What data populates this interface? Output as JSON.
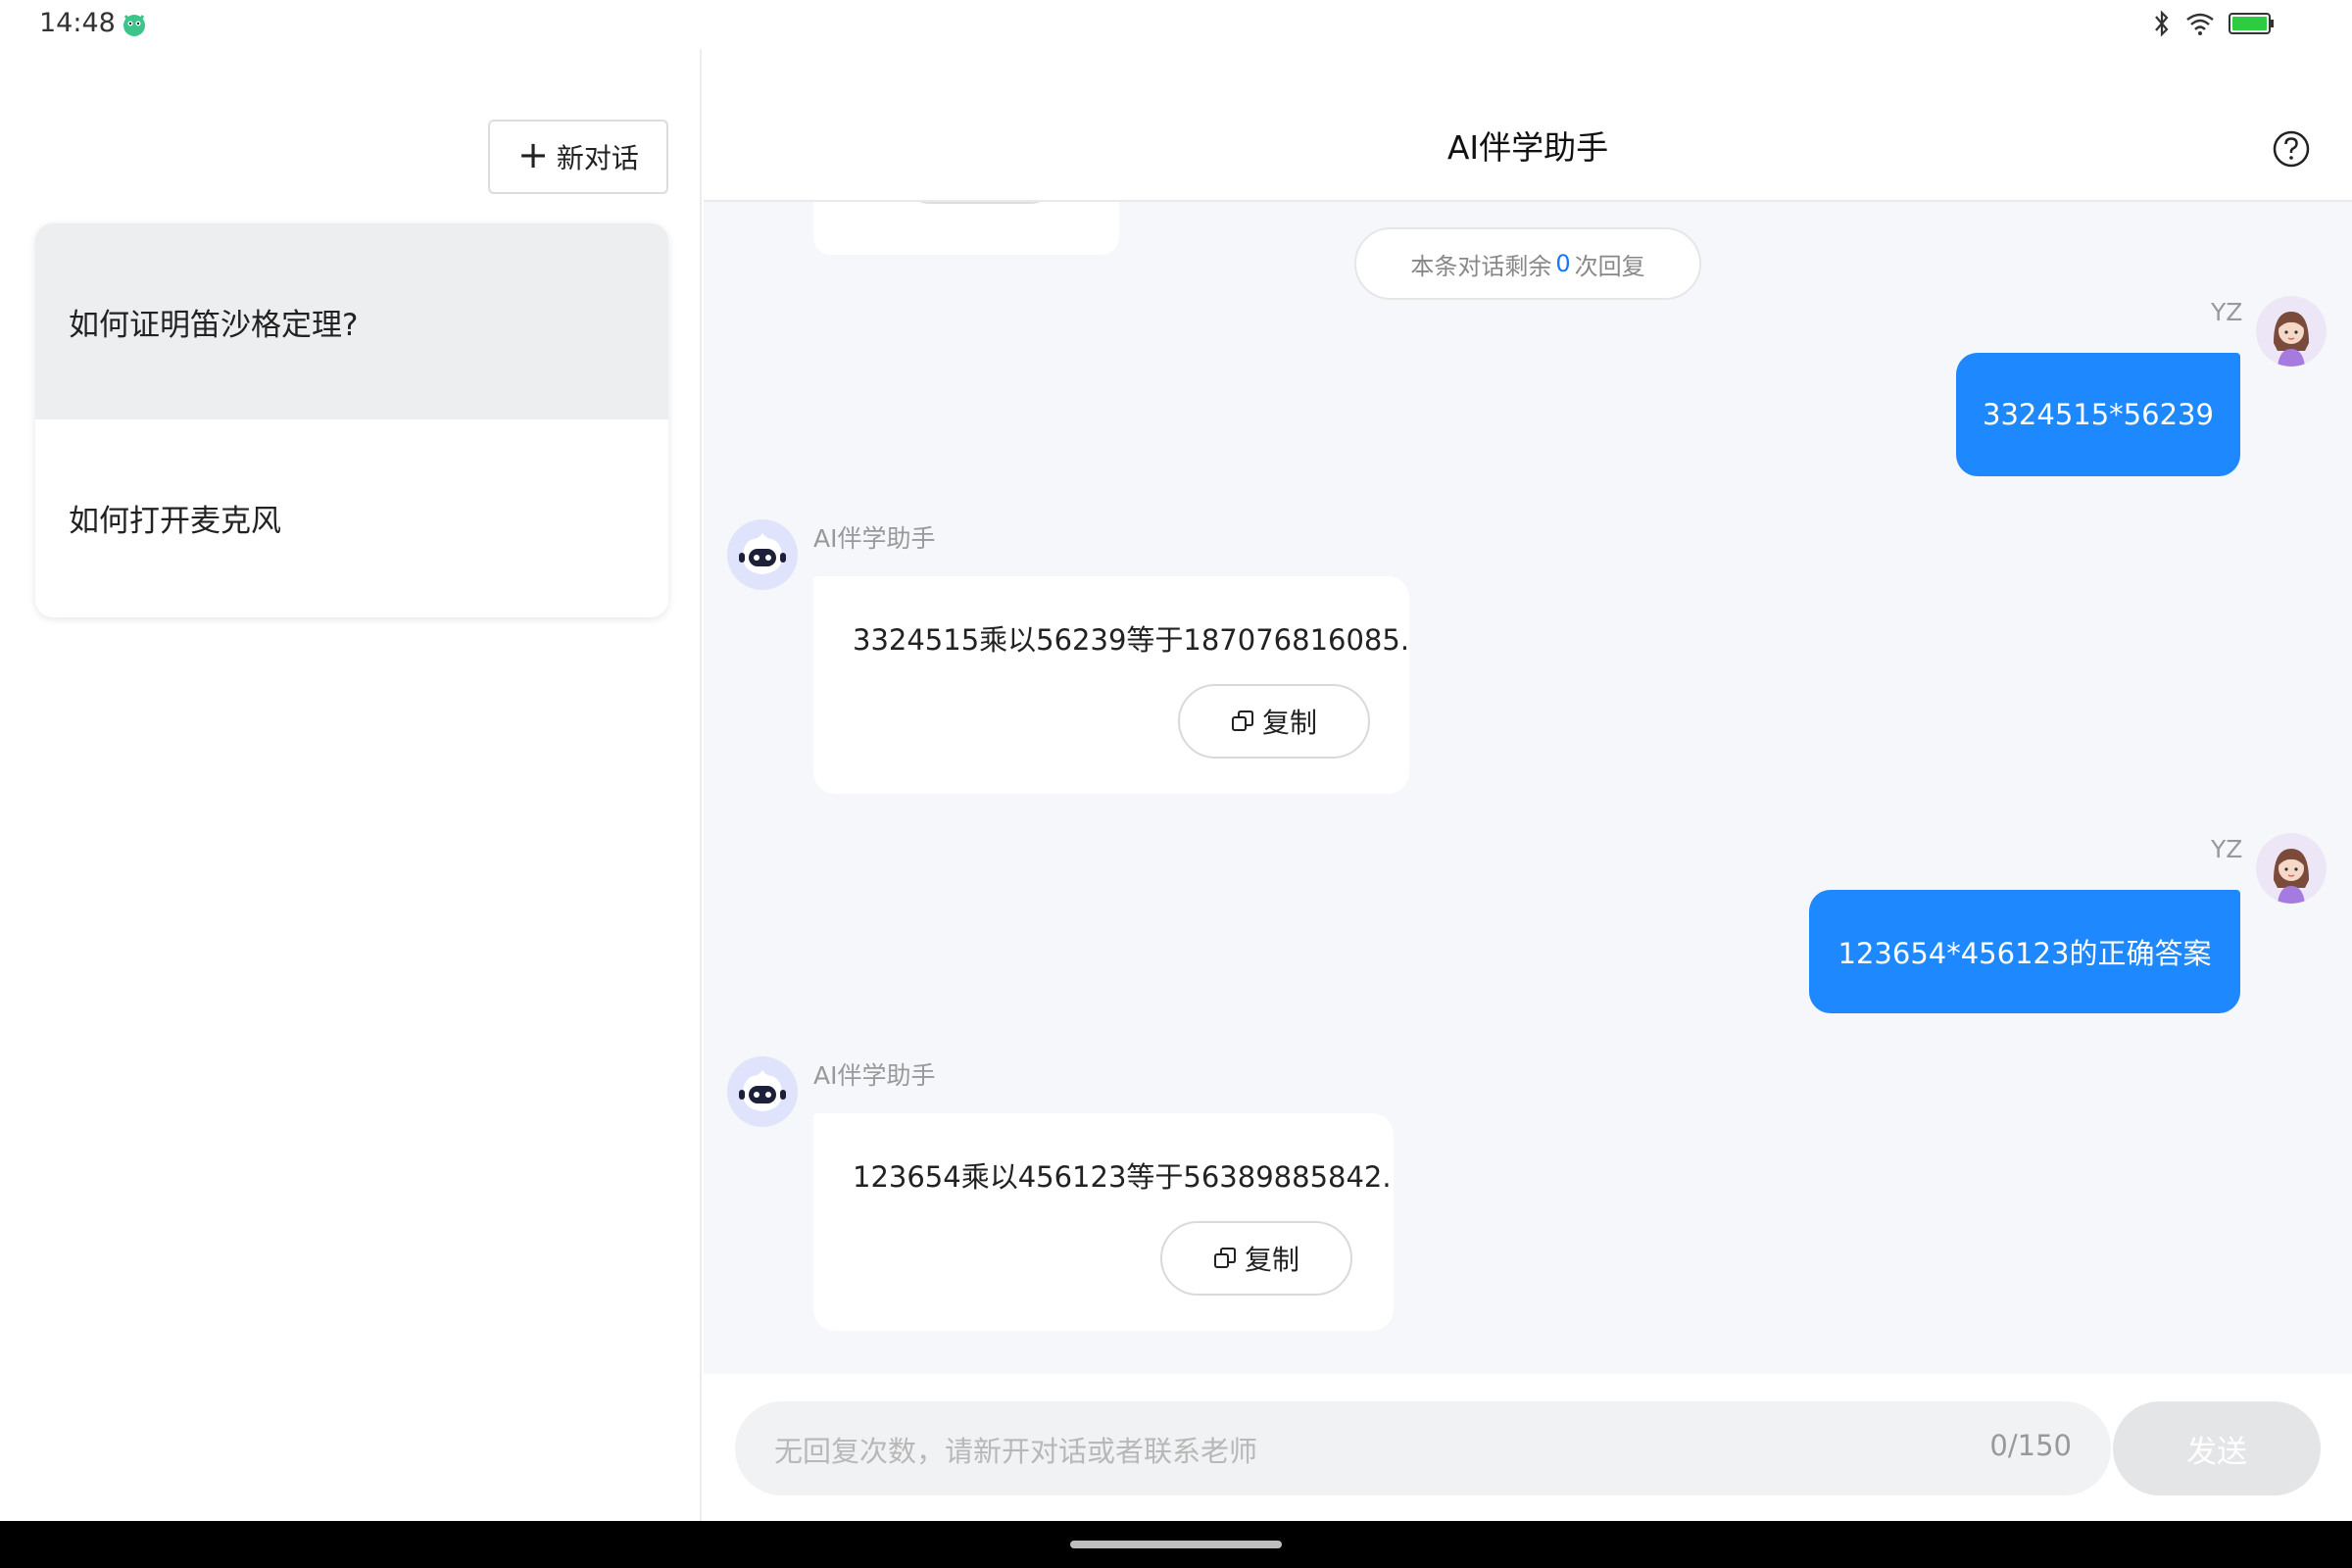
{
  "status_bar": {
    "time": "14:48",
    "battery": "100"
  },
  "sidebar": {
    "new_chat_label": "新对话",
    "conversations": [
      {
        "title": "如何证明笛沙格定理?"
      },
      {
        "title": "如何打开麦克风"
      }
    ]
  },
  "header": {
    "title": "AI伴学助手"
  },
  "chat": {
    "remaining_prefix": "本条对话剩余",
    "remaining_count": "0",
    "remaining_suffix": "次回复",
    "messages": [
      {
        "sender": "YZ",
        "text": "3324515*56239"
      },
      {
        "sender": "AI伴学助手",
        "text": "3324515乘以56239等于187076816085.",
        "copy_label": "复制"
      },
      {
        "sender": "YZ",
        "text": "123654*456123的正确答案"
      },
      {
        "sender": "AI伴学助手",
        "text": "123654乘以456123等于56389885842.",
        "copy_label": "复制"
      }
    ]
  },
  "input": {
    "placeholder": "无回复次数，请新开对话或者联系老师",
    "counter": "0/150",
    "send_label": "发送"
  },
  "colors": {
    "accent": "#1e88ff",
    "user_bubble": "#1e88ff",
    "chat_bg": "#f5f7fa"
  }
}
